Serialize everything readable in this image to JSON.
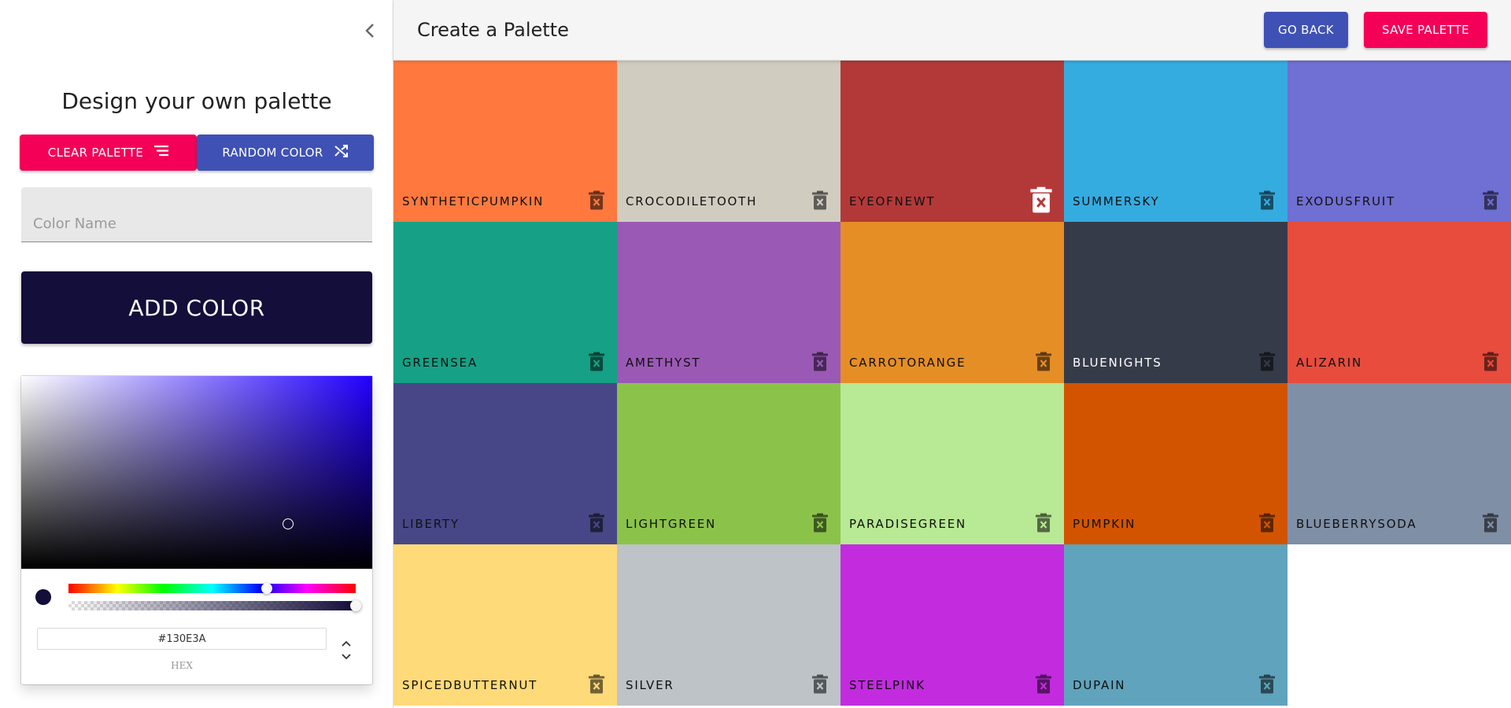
{
  "drawer": {
    "title": "Design your own palette",
    "clear_label": "CLEAR PALETTE",
    "random_label": "RANDOM COLOR",
    "color_name_placeholder": "Color Name",
    "add_label": "ADD COLOR"
  },
  "picker": {
    "hex_value": "#130E3A",
    "hex_label": "HEX",
    "current_color": "#130E3A",
    "hue_position": 0.69,
    "alpha_position": 1.0
  },
  "appbar": {
    "title": "Create a Palette",
    "back_label": "GO BACK",
    "save_label": "SAVE PALETTE"
  },
  "colors": [
    {
      "name": "SyntheticPumpkin",
      "color": "#FF793F",
      "text": "dark"
    },
    {
      "name": "CrocodileTooth",
      "color": "#D1CCC0",
      "text": "dark"
    },
    {
      "name": "EyeOfNewt",
      "color": "#B33939",
      "text": "dark",
      "active": true
    },
    {
      "name": "SummerSky",
      "color": "#34ACE0",
      "text": "dark"
    },
    {
      "name": "ExodusFruit",
      "color": "#706FD3",
      "text": "dark"
    },
    {
      "name": "GreenSea",
      "color": "#16A085",
      "text": "dark"
    },
    {
      "name": "Amethyst",
      "color": "#9B59B6",
      "text": "dark"
    },
    {
      "name": "CarrotOrange",
      "color": "#E58E26",
      "text": "dark"
    },
    {
      "name": "BlueNights",
      "color": "#353B48",
      "text": "light"
    },
    {
      "name": "Alizarin",
      "color": "#E74C3C",
      "text": "dark"
    },
    {
      "name": "Liberty",
      "color": "#474787",
      "text": "dark"
    },
    {
      "name": "LightGreen",
      "color": "#8BC34A",
      "text": "dark"
    },
    {
      "name": "ParadiseGreen",
      "color": "#B8E994",
      "text": "dark"
    },
    {
      "name": "Pumpkin",
      "color": "#D35400",
      "text": "dark"
    },
    {
      "name": "BlueberrySoda",
      "color": "#7F8FA6",
      "text": "dark"
    },
    {
      "name": "SpicedButternut",
      "color": "#FFDA79",
      "text": "dark"
    },
    {
      "name": "Silver",
      "color": "#BDC3C7",
      "text": "dark"
    },
    {
      "name": "SteelPink",
      "color": "#C32BDF",
      "text": "dark"
    },
    {
      "name": "Dupain",
      "color": "#60A3BC",
      "text": "dark"
    }
  ]
}
